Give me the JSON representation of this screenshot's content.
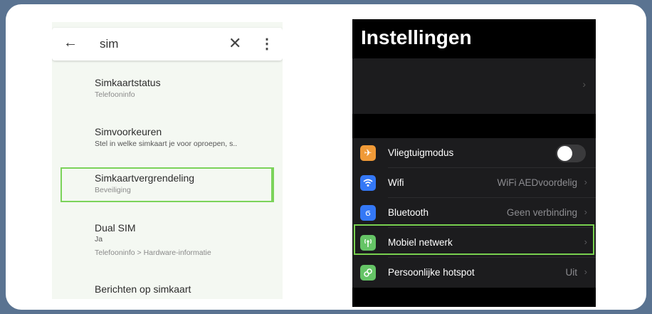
{
  "android": {
    "search": {
      "query": "sim"
    },
    "items": [
      {
        "title": "Simkaartstatus",
        "subtitle": "Telefooninfo"
      },
      {
        "title": "Simvoorkeuren",
        "subtitle": "Stel in welke simkaart je voor oproepen, s.."
      },
      {
        "title": "Simkaartvergrendeling",
        "subtitle": "Beveiliging",
        "highlighted": true
      },
      {
        "title": "Dual SIM",
        "value": "Ja",
        "subtitle": "Telefooninfo > Hardware-informatie"
      },
      {
        "title": "Berichten op simkaart"
      }
    ]
  },
  "ios": {
    "title": "Instellingen",
    "rows": [
      {
        "label": "Vliegtuigmodus",
        "icon": "airplane-icon",
        "color": "#f09a37",
        "toggle": false
      },
      {
        "label": "Wifi",
        "value": "WiFi AEDvoordelig",
        "icon": "wifi-icon",
        "color": "#3478f6"
      },
      {
        "label": "Bluetooth",
        "value": "Geen verbinding",
        "icon": "bluetooth-icon",
        "color": "#3478f6"
      },
      {
        "label": "Mobiel netwerk",
        "icon": "antenna-icon",
        "color": "#65c466",
        "highlighted": true
      },
      {
        "label": "Persoonlijke hotspot",
        "value": "Uit",
        "icon": "hotspot-icon",
        "color": "#65c466"
      }
    ]
  },
  "colors": {
    "highlight": "#7bd35a",
    "page_background": "#5a7391"
  }
}
